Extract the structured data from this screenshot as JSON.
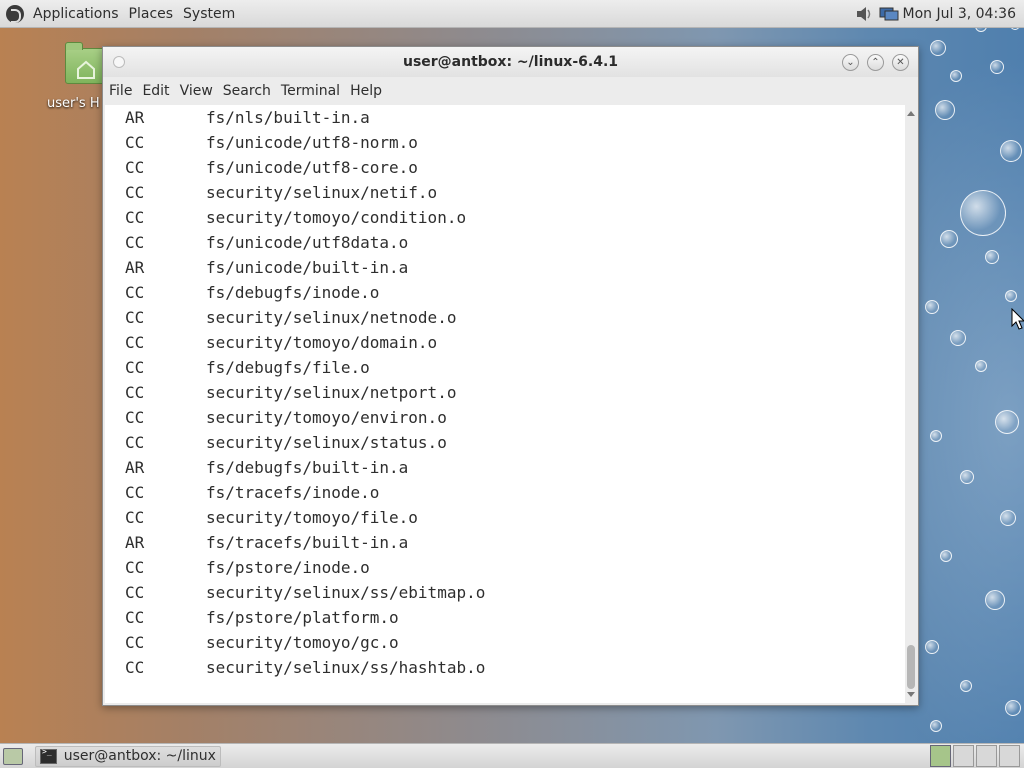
{
  "top_panel": {
    "menus": [
      "Applications",
      "Places",
      "System"
    ],
    "clock": "Mon Jul 3, 04:36"
  },
  "desktop": {
    "home_icon_label": "user's H"
  },
  "terminal": {
    "title": "user@antbox: ~/linux-6.4.1",
    "menus": [
      "File",
      "Edit",
      "View",
      "Search",
      "Terminal",
      "Help"
    ],
    "lines": [
      {
        "code": "AR",
        "path": "fs/nls/built-in.a"
      },
      {
        "code": "CC",
        "path": "fs/unicode/utf8-norm.o"
      },
      {
        "code": "CC",
        "path": "fs/unicode/utf8-core.o"
      },
      {
        "code": "CC",
        "path": "security/selinux/netif.o"
      },
      {
        "code": "CC",
        "path": "security/tomoyo/condition.o"
      },
      {
        "code": "CC",
        "path": "fs/unicode/utf8data.o"
      },
      {
        "code": "AR",
        "path": "fs/unicode/built-in.a"
      },
      {
        "code": "CC",
        "path": "fs/debugfs/inode.o"
      },
      {
        "code": "CC",
        "path": "security/selinux/netnode.o"
      },
      {
        "code": "CC",
        "path": "security/tomoyo/domain.o"
      },
      {
        "code": "CC",
        "path": "fs/debugfs/file.o"
      },
      {
        "code": "CC",
        "path": "security/selinux/netport.o"
      },
      {
        "code": "CC",
        "path": "security/tomoyo/environ.o"
      },
      {
        "code": "CC",
        "path": "security/selinux/status.o"
      },
      {
        "code": "AR",
        "path": "fs/debugfs/built-in.a"
      },
      {
        "code": "CC",
        "path": "fs/tracefs/inode.o"
      },
      {
        "code": "CC",
        "path": "security/tomoyo/file.o"
      },
      {
        "code": "AR",
        "path": "fs/tracefs/built-in.a"
      },
      {
        "code": "CC",
        "path": "fs/pstore/inode.o"
      },
      {
        "code": "CC",
        "path": "security/selinux/ss/ebitmap.o"
      },
      {
        "code": "CC",
        "path": "fs/pstore/platform.o"
      },
      {
        "code": "CC",
        "path": "security/tomoyo/gc.o"
      },
      {
        "code": "CC",
        "path": "security/selinux/ss/hashtab.o"
      }
    ]
  },
  "taskbar": {
    "task_label": "user@antbox: ~/linux..."
  }
}
